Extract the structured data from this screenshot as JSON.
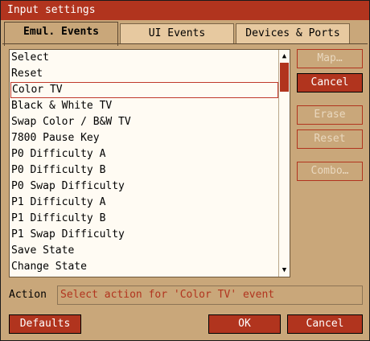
{
  "window": {
    "title": "Input settings"
  },
  "tabs": [
    {
      "label": "Emul. Events",
      "active": true
    },
    {
      "label": "UI Events",
      "active": false
    },
    {
      "label": "Devices & Ports",
      "active": false
    }
  ],
  "events_list": {
    "items": [
      "Select",
      "Reset",
      "Color TV",
      "Black & White TV",
      "Swap Color / B&W TV",
      "7800 Pause Key",
      "P0 Difficulty A",
      "P0 Difficulty B",
      "P0 Swap Difficulty",
      "P1 Difficulty A",
      "P1 Difficulty B",
      "P1 Swap Difficulty",
      "Save State",
      "Change State"
    ],
    "selected_index": 2
  },
  "side_buttons": {
    "map": "Map…",
    "cancel": "Cancel",
    "erase": "Erase",
    "reset": "Reset",
    "combo": "Combo…"
  },
  "action": {
    "label": "Action",
    "text": "Select action for 'Color TV' event"
  },
  "footer": {
    "defaults": "Defaults",
    "ok": "OK",
    "cancel": "Cancel"
  },
  "colors": {
    "accent": "#b1341e",
    "background": "#c9a77a",
    "list_background": "#fffbf3"
  },
  "icons": {
    "scroll_up": "scroll-up-icon",
    "scroll_down": "scroll-down-icon"
  }
}
